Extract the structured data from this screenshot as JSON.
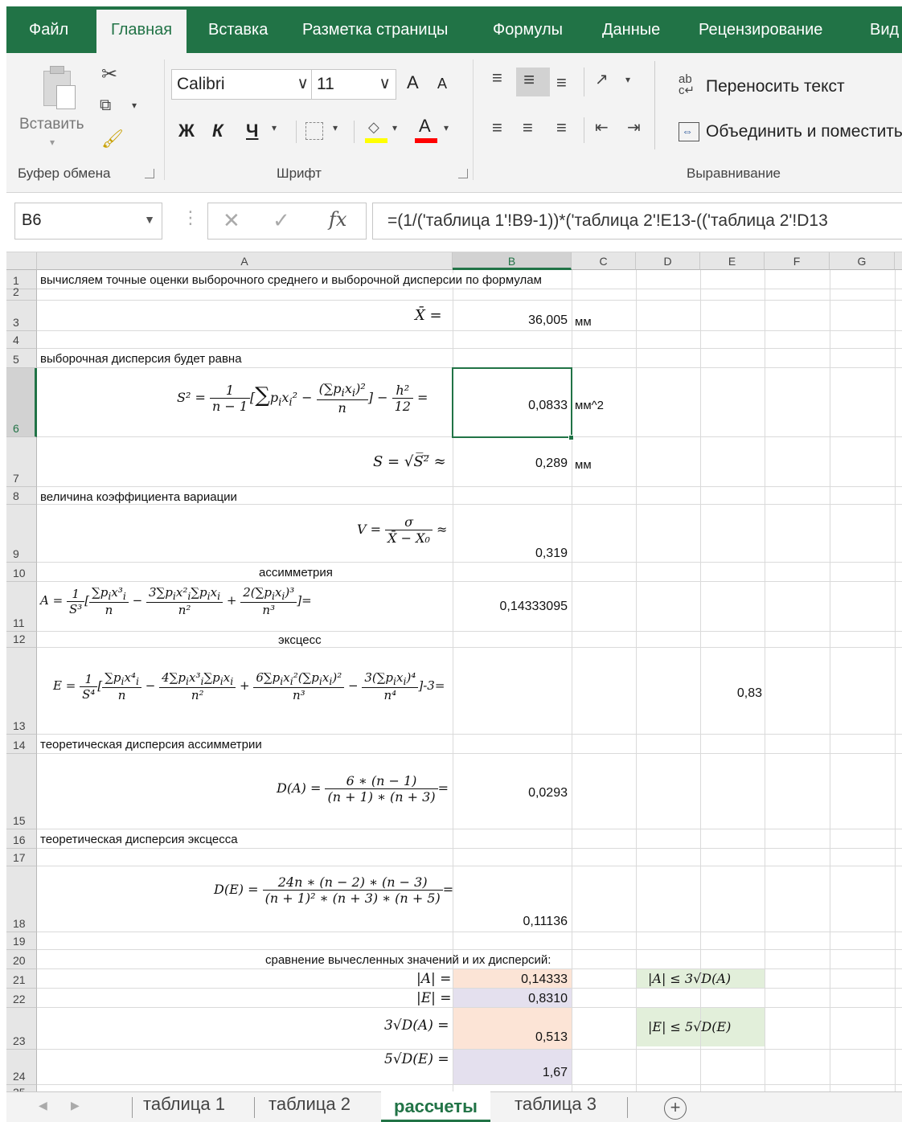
{
  "ribbon_tabs": [
    "Файл",
    "Главная",
    "Вставка",
    "Разметка страницы",
    "Формулы",
    "Данные",
    "Рецензирование",
    "Вид"
  ],
  "clipboard": {
    "paste_label": "Вставить",
    "group_label": "Буфер обмена"
  },
  "font": {
    "name": "Calibri",
    "size": "11",
    "bold": "Ж",
    "italic": "К",
    "underline": "Ч",
    "group_label": "Шрифт",
    "grow": "A",
    "shrink": "A",
    "color_letter": "A"
  },
  "alignment": {
    "wrap_text": "Переносить текст",
    "merge": "Объединить и поместить",
    "group_label": "Выравнивание"
  },
  "formula_bar": {
    "name_box": "B6",
    "fx": "fx",
    "formula": "=(1/('таблица 1'!B9-1))*('таблица 2'!E13-(('таблица 2'!D13"
  },
  "columns": [
    "A",
    "B",
    "C",
    "D",
    "E",
    "F",
    "G"
  ],
  "rows": [
    "1",
    "2",
    "3",
    "4",
    "5",
    "6",
    "7",
    "8",
    "9",
    "10",
    "11",
    "12",
    "13",
    "14",
    "15",
    "16",
    "17",
    "18",
    "19",
    "20",
    "21",
    "22",
    "23",
    "24",
    "25"
  ],
  "cells": {
    "r1": "вычисляем точные оценки выборочного среднего и выборочной дисперсии по формулам",
    "r3_val": "36,005",
    "r3_unit": "мм",
    "r5": "выборочная дисперсия будет равна",
    "r6_val": "0,0833",
    "r6_unit": "мм^2",
    "r7_val": "0,289",
    "r7_unit": "мм",
    "r8": "величина коэффициента вариации",
    "r9_val": "0,319",
    "r10": "ассимметрия",
    "r11_val": "0,14333095",
    "r12": "эксцесс",
    "r13_val": "0,83",
    "r14": "теоретическая дисперсия ассимметрии",
    "r15_val": "0,0293",
    "r16": "теоретическая дисперсия эксцесса",
    "r18_val": "0,11136",
    "r20": "сравнение вычесленных значений и их дисперсий:",
    "r21_val": "0,14333",
    "r22_val": "0,8310",
    "r23_val": "0,513",
    "r24_val": "1,67"
  },
  "sheet_tabs": [
    "таблица 1",
    "таблица 2",
    "рассчеты",
    "таблица 3"
  ],
  "colors": {
    "excel_green": "#217346",
    "peach": "#fce4d6",
    "lavender": "#e4e0ee",
    "light_green": "#e2efda"
  }
}
